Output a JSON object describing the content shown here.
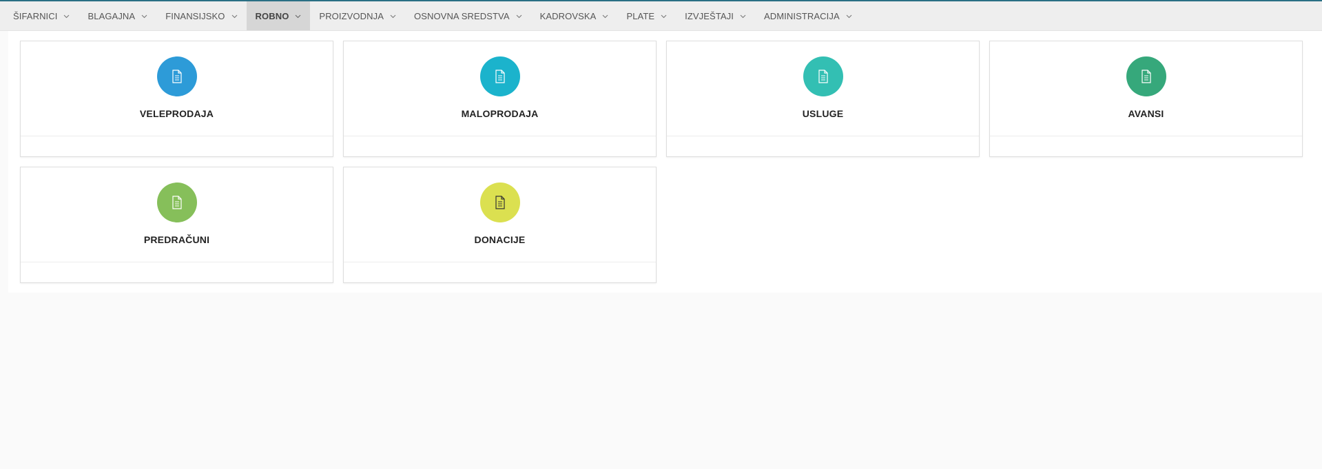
{
  "nav": {
    "items": [
      {
        "label": "ŠIFARNICI",
        "active": false
      },
      {
        "label": "BLAGAJNA",
        "active": false
      },
      {
        "label": "FINANSIJSKO",
        "active": false
      },
      {
        "label": "ROBNO",
        "active": true
      },
      {
        "label": "PROIZVODNJA",
        "active": false
      },
      {
        "label": "OSNOVNA SREDSTVA",
        "active": false
      },
      {
        "label": "KADROVSKA",
        "active": false
      },
      {
        "label": "PLATE",
        "active": false
      },
      {
        "label": "IZVJEŠTAJI",
        "active": false
      },
      {
        "label": "ADMINISTRACIJA",
        "active": false
      }
    ]
  },
  "tiles": [
    {
      "label": "VELEPRODAJA",
      "color": "#2d9bd8",
      "icon": "document-icon"
    },
    {
      "label": "MALOPRODAJA",
      "color": "#1bb3cc",
      "icon": "document-icon"
    },
    {
      "label": "USLUGE",
      "color": "#33bfb3",
      "icon": "document-icon"
    },
    {
      "label": "AVANSI",
      "color": "#36a87b",
      "icon": "document-icon"
    },
    {
      "label": "PREDRAČUNI",
      "color": "#86bf5a",
      "icon": "document-icon"
    },
    {
      "label": "DONACIJE",
      "color": "#dbe050",
      "icon": "document-icon"
    }
  ],
  "colors": {
    "topline": "#2a6f84",
    "navbar": "#eeeeee",
    "nav_active": "#d6d6d6"
  }
}
